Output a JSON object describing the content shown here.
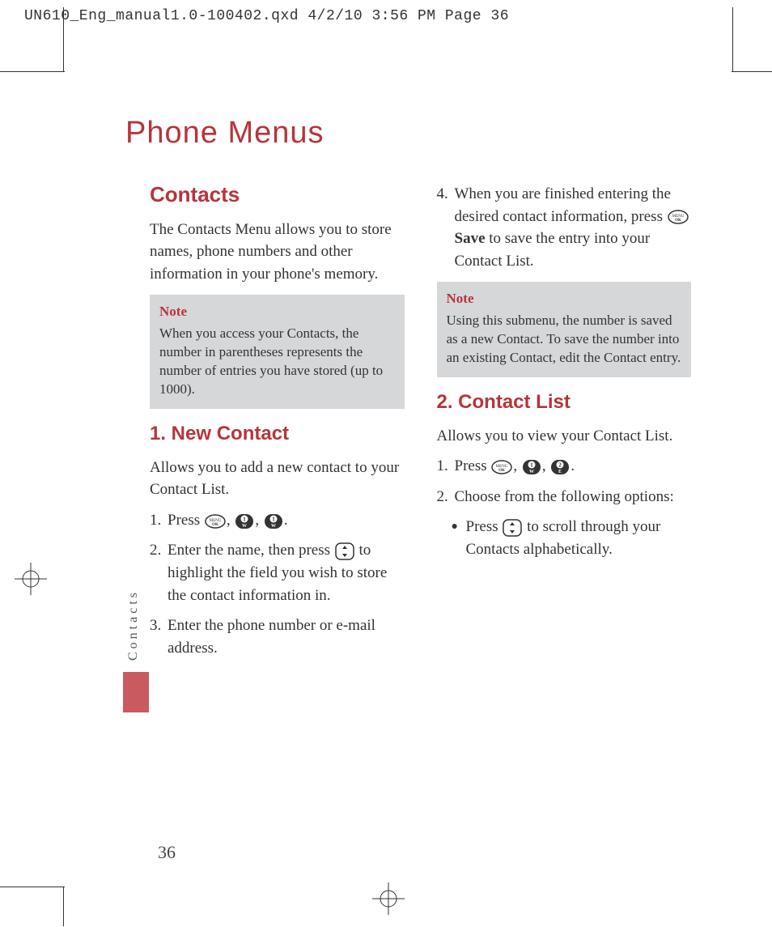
{
  "prepress_header": "UN610_Eng_manual1.0-100402.qxd  4/2/10  3:56 PM  Page 36",
  "chapter_title": "Phone Menus",
  "side_tab": "Contacts",
  "page_number": "36",
  "left": {
    "section_title": "Contacts",
    "intro": "The Contacts Menu allows you to store names, phone numbers and other information in your phone's memory.",
    "note_label": "Note",
    "note_body": "When you access your Contacts, the number in parentheses represents the number of entries you have stored (up to 1000).",
    "sub_title": "1. New Contact",
    "sub_intro": "Allows you to add a new contact to your Contact List.",
    "step1_num": "1.",
    "step1_a": "Press ",
    "step2_num": "2.",
    "step2_a": "Enter the name, then press",
    "step2_b": " to highlight the field you wish to store the contact information in.",
    "step3_num": "3.",
    "step3_body": "Enter the phone number or e-mail address."
  },
  "right": {
    "step4_num": "4.",
    "step4_a": "When you are finished entering the desired contact information, press ",
    "step4_save": "Save",
    "step4_b": " to save the entry into your Contact List.",
    "note_label": "Note",
    "note_body": "Using this submenu, the number is saved as a new Contact. To save the number into an existing Contact, edit the Contact entry.",
    "sub_title": "2. Contact List",
    "sub_intro": "Allows you to view your Contact List.",
    "step1_num": "1.",
    "step1_a": "Press ",
    "step2_num": "2.",
    "step2_body": "Choose from the following options:",
    "bullet_a": "Press ",
    "bullet_b": " to scroll through your Contacts alphabetically."
  },
  "icons": {
    "ok": "menu-ok-key",
    "one": "one-key",
    "two": "two-key",
    "nav": "nav-key"
  }
}
